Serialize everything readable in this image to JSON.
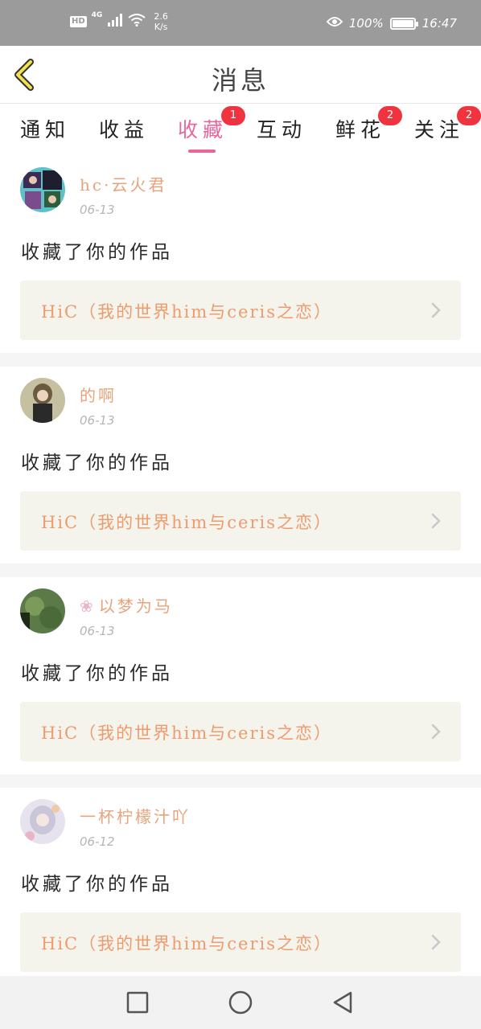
{
  "status_bar": {
    "hd": "HD",
    "network": "4G",
    "speed_value": "2.6",
    "speed_unit": "K/s",
    "battery": "100%",
    "battery_level": 1.0,
    "time": "16:47"
  },
  "header": {
    "title": "消息",
    "back_icon": "chevron-left-icon"
  },
  "tabs": [
    {
      "label": "通知",
      "badge": ""
    },
    {
      "label": "收益",
      "badge": ""
    },
    {
      "label": "收藏",
      "badge": "1",
      "active": true
    },
    {
      "label": "互动",
      "badge": ""
    },
    {
      "label": "鲜花",
      "badge": "2"
    },
    {
      "label": "关注",
      "badge": "2"
    }
  ],
  "messages": [
    {
      "user": "hc·云火君",
      "date": "06-13",
      "action": "收藏了你的作品",
      "work": "HiC（我的世界him与ceris之恋）"
    },
    {
      "user": "的啊",
      "date": "06-13",
      "action": "收藏了你的作品",
      "work": "HiC（我的世界him与ceris之恋）"
    },
    {
      "user_icon": "❀",
      "user": "以梦为马",
      "date": "06-13",
      "action": "收藏了你的作品",
      "work": "HiC（我的世界him与ceris之恋）"
    },
    {
      "user": "一杯柠檬汁吖",
      "date": "06-12",
      "action": "收藏了你的作品",
      "work": "HiC（我的世界him与ceris之恋）"
    }
  ],
  "colors": {
    "accent": "#e9659b",
    "badge": "#f0333f",
    "username": "#e8a37a",
    "work_title": "#ee9b6d",
    "work_bg": "#f4f3ec"
  }
}
